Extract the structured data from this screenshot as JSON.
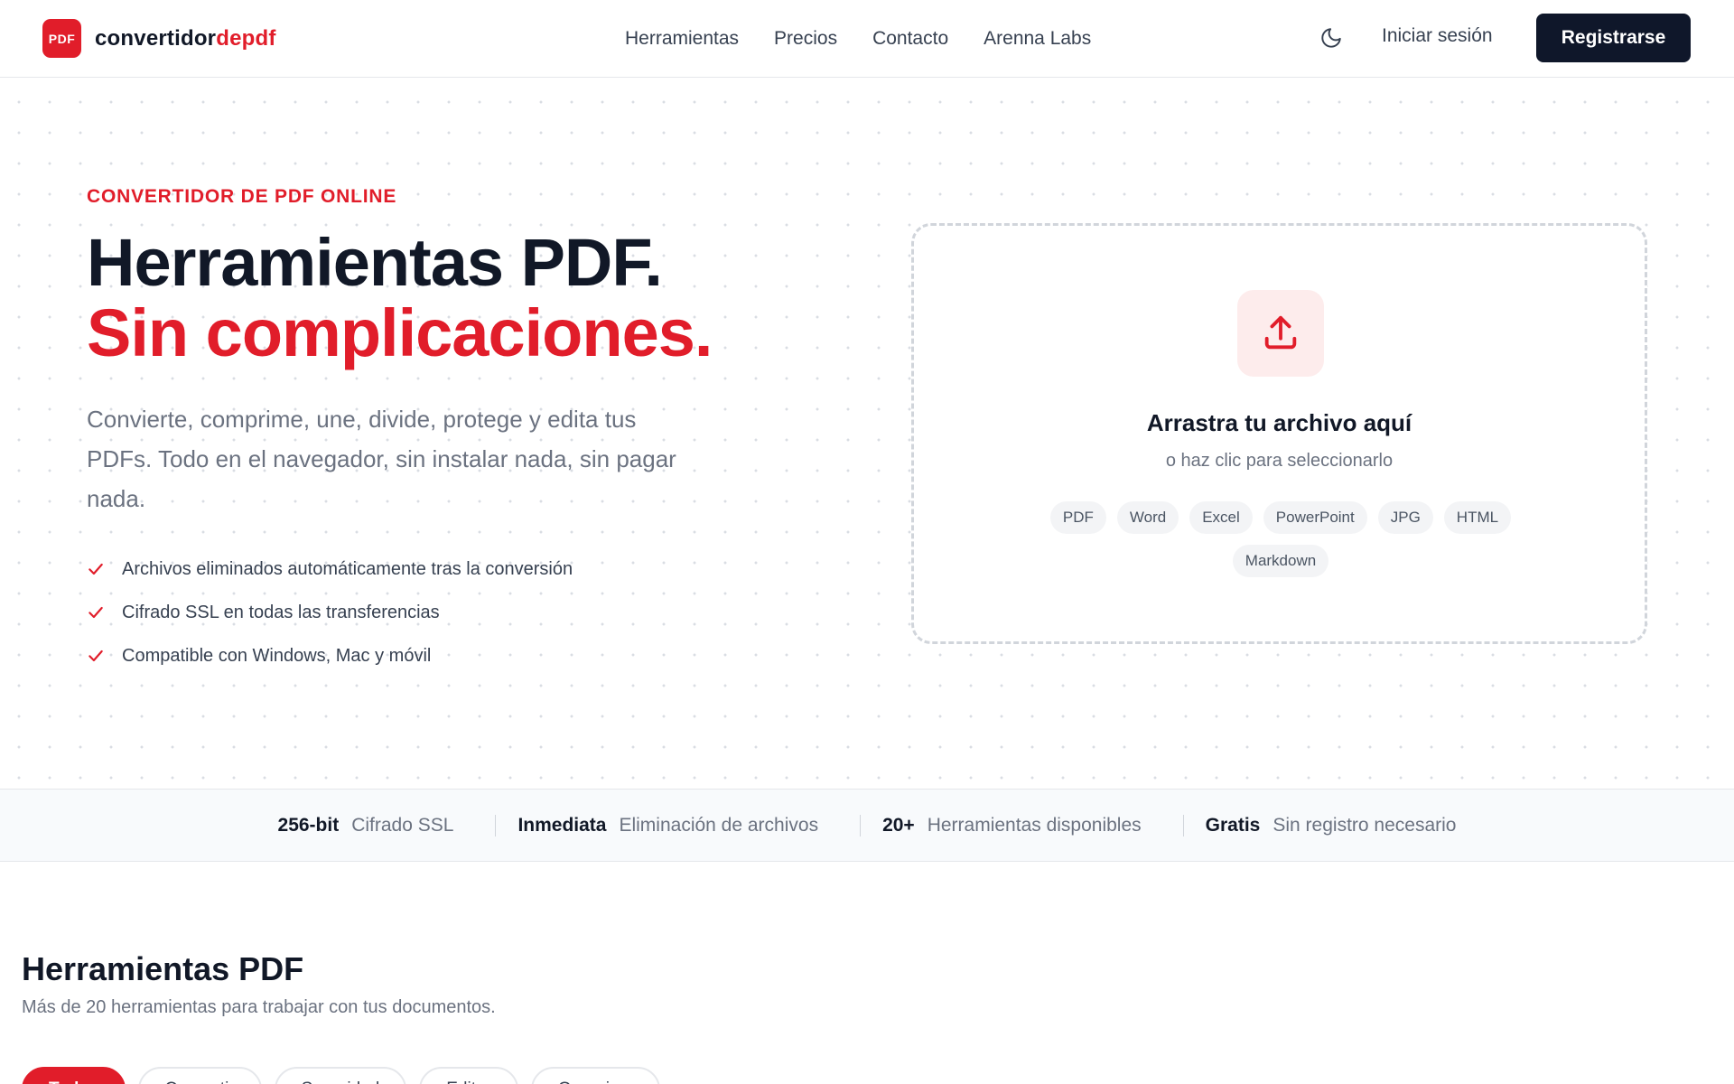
{
  "header": {
    "logo_badge": "PDF",
    "logo_main": "convertidor",
    "logo_accent": "depdf",
    "nav": [
      "Herramientas",
      "Precios",
      "Contacto",
      "Arenna Labs"
    ],
    "theme_icon": "moon-icon",
    "login_label": "Iniciar sesión",
    "register_label": "Registrarse"
  },
  "hero": {
    "eyebrow": "CONVERTIDOR DE PDF ONLINE",
    "title_line1": "Herramientas PDF.",
    "title_line2": "Sin complicaciones.",
    "subtitle": "Convierte, comprime, une, divide, protege y edita tus PDFs. Todo en el navegador, sin instalar nada, sin pagar nada.",
    "features": [
      "Archivos eliminados automáticamente tras la conversión",
      "Cifrado SSL en todas las transferencias",
      "Compatible con Windows, Mac y móvil"
    ]
  },
  "dropzone": {
    "icon": "upload-icon",
    "title": "Arrastra tu archivo aquí",
    "subtitle": "o haz clic para seleccionarlo",
    "formats": [
      "PDF",
      "Word",
      "Excel",
      "PowerPoint",
      "JPG",
      "HTML",
      "Markdown"
    ]
  },
  "stats": [
    {
      "value": "256-bit",
      "label": "Cifrado SSL"
    },
    {
      "value": "Inmediata",
      "label": "Eliminación de archivos"
    },
    {
      "value": "20+",
      "label": "Herramientas disponibles"
    },
    {
      "value": "Gratis",
      "label": "Sin registro necesario"
    }
  ],
  "tools": {
    "title": "Herramientas PDF",
    "subtitle": "Más de 20 herramientas para trabajar con tus documentos.",
    "filters": [
      "Todas",
      "Convertir",
      "Seguridad",
      "Editar",
      "Organizar"
    ]
  },
  "colors": {
    "accent": "#e11d2a",
    "dark": "#0f172a",
    "muted": "#6b7280"
  }
}
